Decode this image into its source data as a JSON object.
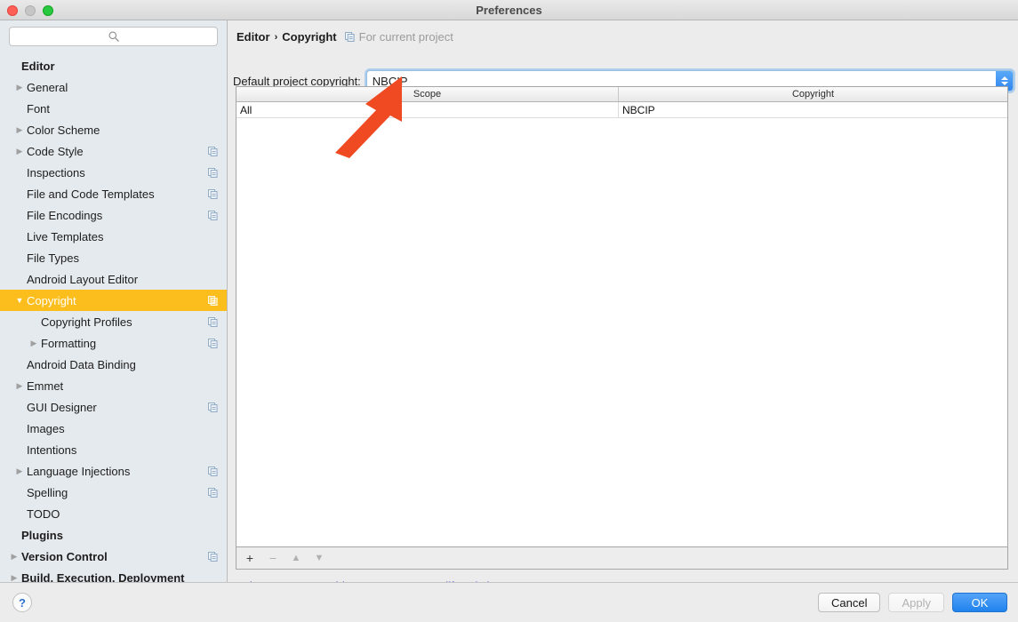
{
  "window": {
    "title": "Preferences",
    "traffic_lights": [
      "close-red",
      "minimize-disabled",
      "zoom-green"
    ]
  },
  "sidebar": {
    "search": {
      "value": "",
      "placeholder": "",
      "icon": "search-icon"
    },
    "items": [
      {
        "label": "Editor",
        "level": 0,
        "bold": true,
        "twisty": "",
        "badge": false,
        "selected": false
      },
      {
        "label": "General",
        "level": 1,
        "bold": false,
        "twisty": "▶",
        "badge": false,
        "selected": false
      },
      {
        "label": "Font",
        "level": 1,
        "bold": false,
        "twisty": "",
        "badge": false,
        "selected": false
      },
      {
        "label": "Color Scheme",
        "level": 1,
        "bold": false,
        "twisty": "▶",
        "badge": false,
        "selected": false
      },
      {
        "label": "Code Style",
        "level": 1,
        "bold": false,
        "twisty": "▶",
        "badge": true,
        "selected": false
      },
      {
        "label": "Inspections",
        "level": 1,
        "bold": false,
        "twisty": "",
        "badge": true,
        "selected": false
      },
      {
        "label": "File and Code Templates",
        "level": 1,
        "bold": false,
        "twisty": "",
        "badge": true,
        "selected": false
      },
      {
        "label": "File Encodings",
        "level": 1,
        "bold": false,
        "twisty": "",
        "badge": true,
        "selected": false
      },
      {
        "label": "Live Templates",
        "level": 1,
        "bold": false,
        "twisty": "",
        "badge": false,
        "selected": false
      },
      {
        "label": "File Types",
        "level": 1,
        "bold": false,
        "twisty": "",
        "badge": false,
        "selected": false
      },
      {
        "label": "Android Layout Editor",
        "level": 1,
        "bold": false,
        "twisty": "",
        "badge": false,
        "selected": false
      },
      {
        "label": "Copyright",
        "level": 1,
        "bold": false,
        "twisty": "▼",
        "badge": true,
        "selected": true
      },
      {
        "label": "Copyright Profiles",
        "level": 2,
        "bold": false,
        "twisty": "",
        "badge": true,
        "selected": false
      },
      {
        "label": "Formatting",
        "level": 2,
        "bold": false,
        "twisty": "▶",
        "badge": true,
        "selected": false
      },
      {
        "label": "Android Data Binding",
        "level": 1,
        "bold": false,
        "twisty": "",
        "badge": false,
        "selected": false
      },
      {
        "label": "Emmet",
        "level": 1,
        "bold": false,
        "twisty": "▶",
        "badge": false,
        "selected": false
      },
      {
        "label": "GUI Designer",
        "level": 1,
        "bold": false,
        "twisty": "",
        "badge": true,
        "selected": false
      },
      {
        "label": "Images",
        "level": 1,
        "bold": false,
        "twisty": "",
        "badge": false,
        "selected": false
      },
      {
        "label": "Intentions",
        "level": 1,
        "bold": false,
        "twisty": "",
        "badge": false,
        "selected": false
      },
      {
        "label": "Language Injections",
        "level": 1,
        "bold": false,
        "twisty": "▶",
        "badge": true,
        "selected": false
      },
      {
        "label": "Spelling",
        "level": 1,
        "bold": false,
        "twisty": "",
        "badge": true,
        "selected": false
      },
      {
        "label": "TODO",
        "level": 1,
        "bold": false,
        "twisty": "",
        "badge": false,
        "selected": false
      },
      {
        "label": "Plugins",
        "level": 0,
        "bold": true,
        "twisty": "",
        "badge": false,
        "selected": false
      },
      {
        "label": "Version Control",
        "level": 0,
        "bold": true,
        "twisty": "▶",
        "badge": true,
        "selected": false
      },
      {
        "label": "Build, Execution, Deployment",
        "level": 0,
        "bold": true,
        "twisty": "▶",
        "badge": false,
        "selected": false
      }
    ]
  },
  "content": {
    "breadcrumb": {
      "parent": "Editor",
      "separator": "›",
      "current": "Copyright",
      "note": "For current project",
      "note_icon": "copy-scope-icon"
    },
    "default_copyright": {
      "label": "Default project copyright:",
      "value": "NBCIP",
      "placeholder": "",
      "stepper_icon": "chevron-up-down-icon"
    },
    "table": {
      "columns": [
        "Scope",
        "Copyright"
      ],
      "rows": [
        {
          "scope": "All",
          "copyright": "NBCIP"
        }
      ]
    },
    "table_toolbar": [
      {
        "name": "add-scope-button",
        "glyph": "+",
        "enabled": true
      },
      {
        "name": "remove-scope-button",
        "glyph": "−",
        "enabled": false
      },
      {
        "name": "move-up-button",
        "glyph": "▲",
        "enabled": false
      },
      {
        "name": "move-down-button",
        "glyph": "▼",
        "enabled": false
      }
    ],
    "scopes_link": "Select Scopes to add new scopes or modify existing ones"
  },
  "footer": {
    "help_label": "?",
    "cancel_label": "Cancel",
    "apply_label": "Apply",
    "ok_label": "OK"
  },
  "annotation": {
    "type": "arrow",
    "color": "#f04a23",
    "points_from": "375,172",
    "points_to": "447,88"
  },
  "colors": {
    "selection": "#fbbe1d",
    "accent_blue": "#2083ee",
    "link": "#2222dd",
    "sidebar_bg": "#e5eaee",
    "window_bg": "#ececec",
    "annotation": "#f04a23"
  }
}
